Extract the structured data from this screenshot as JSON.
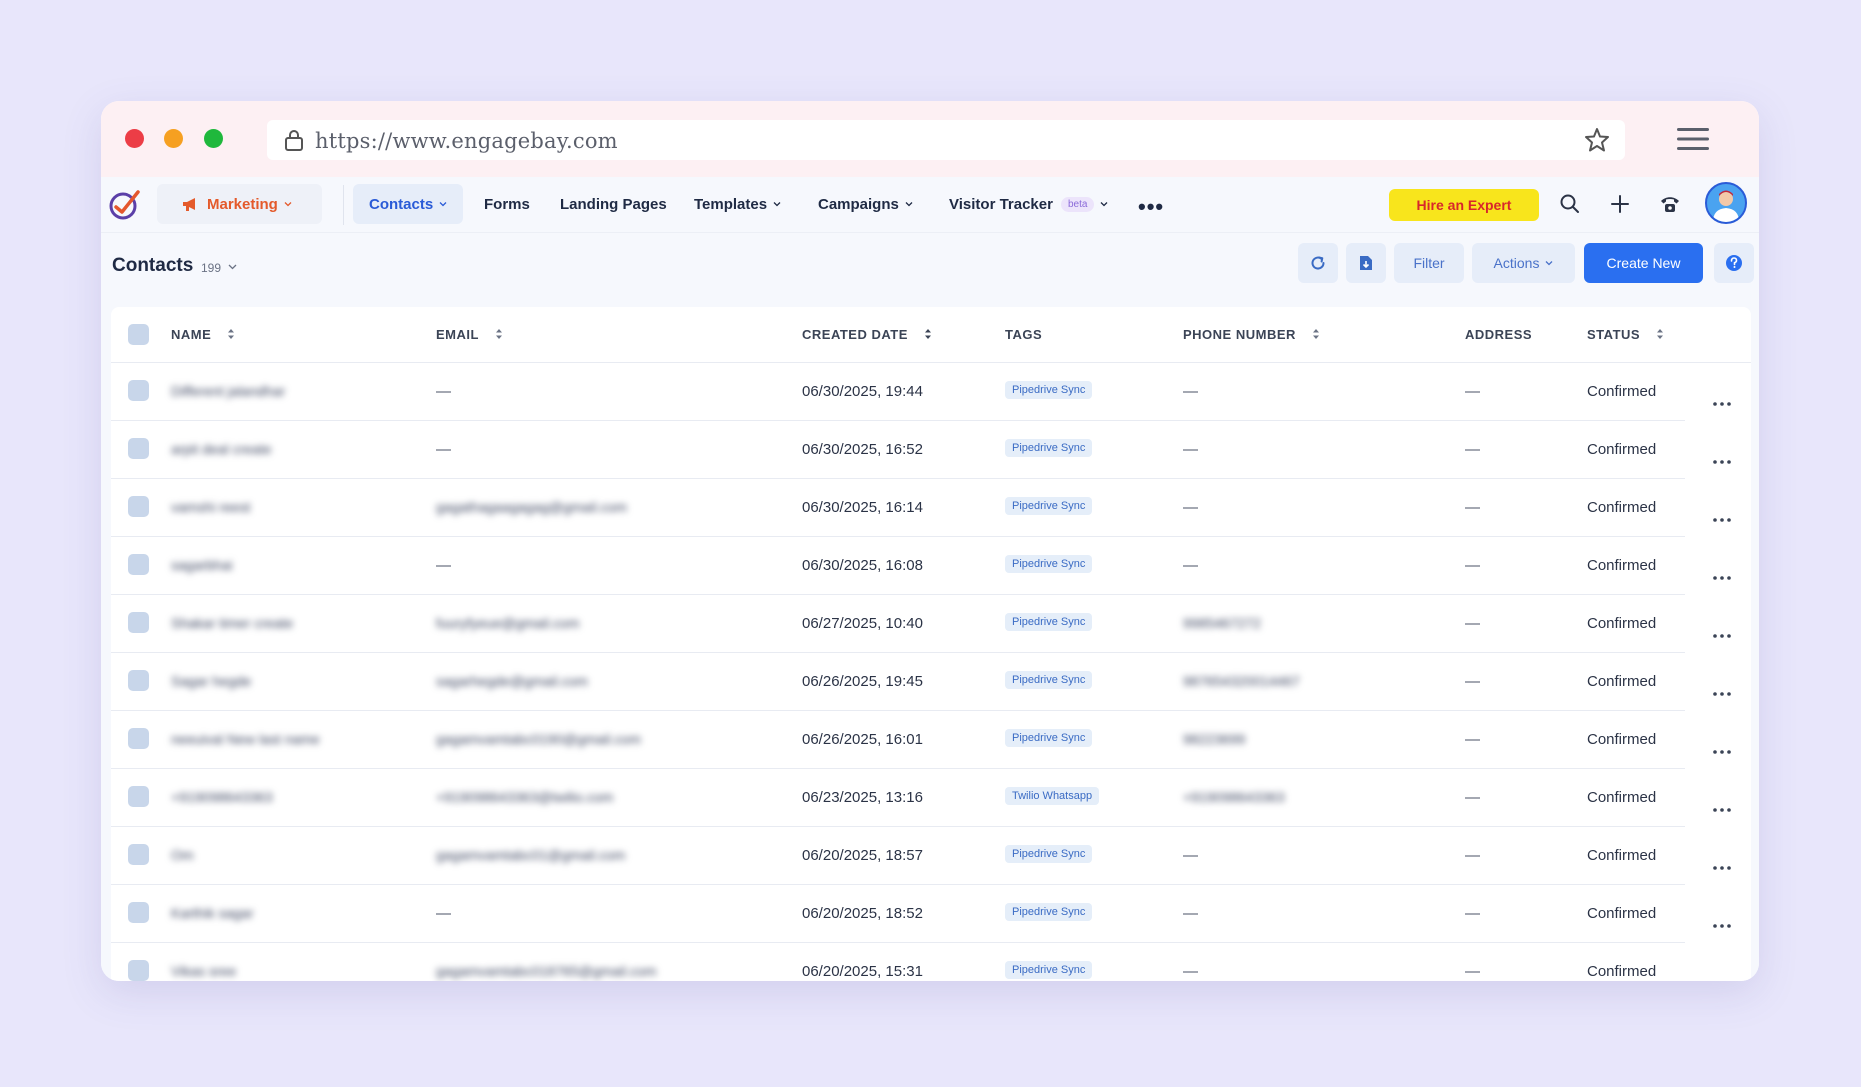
{
  "browser": {
    "url": "https://www.engagebay.com"
  },
  "nav": {
    "marketing_label": "Marketing",
    "items": [
      {
        "label": "Contacts",
        "active": true,
        "chevron": true
      },
      {
        "label": "Forms",
        "active": false,
        "chevron": false
      },
      {
        "label": "Landing Pages",
        "active": false,
        "chevron": false
      },
      {
        "label": "Templates",
        "active": false,
        "chevron": true
      },
      {
        "label": "Campaigns",
        "active": false,
        "chevron": true
      },
      {
        "label": "Visitor Tracker",
        "active": false,
        "chevron": true
      }
    ],
    "beta_label": "beta",
    "hire_label": "Hire an Expert"
  },
  "header": {
    "title": "Contacts",
    "count": "199",
    "filter_label": "Filter",
    "actions_label": "Actions",
    "create_label": "Create New"
  },
  "table": {
    "columns": {
      "name": "NAME",
      "email": "EMAIL",
      "created": "CREATED DATE",
      "tags": "TAGS",
      "phone": "PHONE NUMBER",
      "address": "ADDRESS",
      "status": "STATUS"
    },
    "rows": [
      {
        "name": "Different jalandhar",
        "email": "—",
        "created": "06/30/2025, 19:44",
        "tag": "Pipedrive Sync",
        "phone": "—",
        "address": "—",
        "status": "Confirmed"
      },
      {
        "name": "arpit deal create",
        "email": "—",
        "created": "06/30/2025, 16:52",
        "tag": "Pipedrive Sync",
        "phone": "—",
        "address": "—",
        "status": "Confirmed"
      },
      {
        "name": "vamshi reest",
        "email": "gagathagaagagag@gmail.com",
        "created": "06/30/2025, 16:14",
        "tag": "Pipedrive Sync",
        "phone": "—",
        "address": "—",
        "status": "Confirmed"
      },
      {
        "name": "sagarbhai",
        "email": "—",
        "created": "06/30/2025, 16:08",
        "tag": "Pipedrive Sync",
        "phone": "—",
        "address": "—",
        "status": "Confirmed"
      },
      {
        "name": "Shakar timer create",
        "email": "fuuryfyeue@gmail.com",
        "created": "06/27/2025, 10:40",
        "tag": "Pipedrive Sync",
        "phone": "9985467272",
        "address": "—",
        "status": "Confirmed"
      },
      {
        "name": "Sagar hegde",
        "email": "sagarhegde@gmail.com",
        "created": "06/26/2025, 19:45",
        "tag": "Pipedrive Sync",
        "phone": "987654320014467",
        "address": "—",
        "status": "Confirmed"
      },
      {
        "name": "neeuival New last name",
        "email": "gagamvamtabc0190@gmail.com",
        "created": "06/26/2025, 16:01",
        "tag": "Pipedrive Sync",
        "phone": "98223699",
        "address": "—",
        "status": "Confirmed"
      },
      {
        "name": "+919098643363",
        "email": "+919098643363@twilio.com",
        "created": "06/23/2025, 13:16",
        "tag": "Twilio Whatsapp",
        "phone": "+919098643363",
        "address": "—",
        "status": "Confirmed"
      },
      {
        "name": "Om",
        "email": "gagamvamtabc01@gmail.com",
        "created": "06/20/2025, 18:57",
        "tag": "Pipedrive Sync",
        "phone": "—",
        "address": "—",
        "status": "Confirmed"
      },
      {
        "name": "Karthik sagar",
        "email": "—",
        "created": "06/20/2025, 18:52",
        "tag": "Pipedrive Sync",
        "phone": "—",
        "address": "—",
        "status": "Confirmed"
      },
      {
        "name": "Vikas sree",
        "email": "gagamvamtabc018765@gmail.com",
        "created": "06/20/2025, 15:31",
        "tag": "Pipedrive Sync",
        "phone": "—",
        "address": "—",
        "status": "Confirmed"
      }
    ]
  },
  "colors": {
    "background": "#e8e6fb",
    "accent": "#2a6ff0",
    "marketing": "#e45a2b",
    "hire_bg": "#f8e51c",
    "hire_text": "#d8262b"
  },
  "icons": [
    "lock-icon",
    "star-icon",
    "hamburger-icon",
    "logo-icon",
    "megaphone-icon",
    "more-icon",
    "search-icon",
    "plus-icon",
    "phone-icon",
    "avatar",
    "refresh-icon",
    "import-icon",
    "help-icon",
    "sort-icon",
    "row-menu-icon"
  ]
}
